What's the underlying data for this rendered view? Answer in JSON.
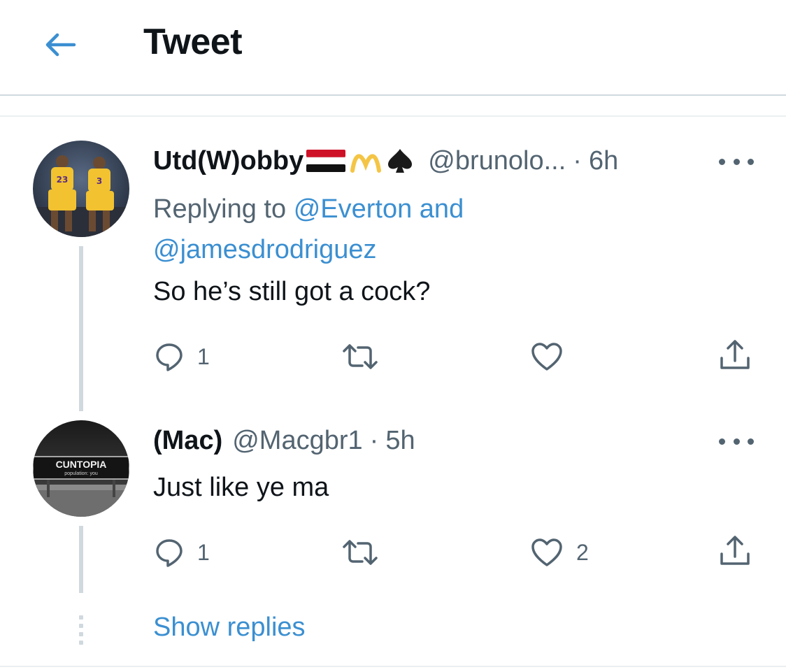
{
  "header": {
    "title": "Tweet",
    "back_icon": "arrow-left-icon"
  },
  "colors": {
    "accent": "#3b8fd1",
    "secondary_text": "#536471",
    "border": "#cfd9de"
  },
  "tweets": [
    {
      "display_name": "Utd(W)obby",
      "name_emojis": [
        "yemen-flag-emoji",
        "yellow-m-logo-emoji",
        "spade-emoji"
      ],
      "handle": "@brunolo...",
      "separator": "·",
      "time": "6h",
      "replying_prefix": "Replying to",
      "replying_to_1": "@Everton",
      "replying_and": "and",
      "replying_to_2": "@jamesdrodriguez",
      "text": "So he’s still got a cock?",
      "reply_count": "1",
      "retweet_count": "",
      "like_count": "",
      "avatar": "basketball-players-avatar"
    },
    {
      "display_name": "(Mac)",
      "handle": "@Macgbr1",
      "separator": "·",
      "time": "5h",
      "text": "Just like ye ma",
      "reply_count": "1",
      "retweet_count": "",
      "like_count": "2",
      "avatar": "road-sign-avatar",
      "avatar_sign_text": "CUNTOPIA",
      "avatar_sign_subtext": "population: you"
    }
  ],
  "show_replies": "Show replies"
}
